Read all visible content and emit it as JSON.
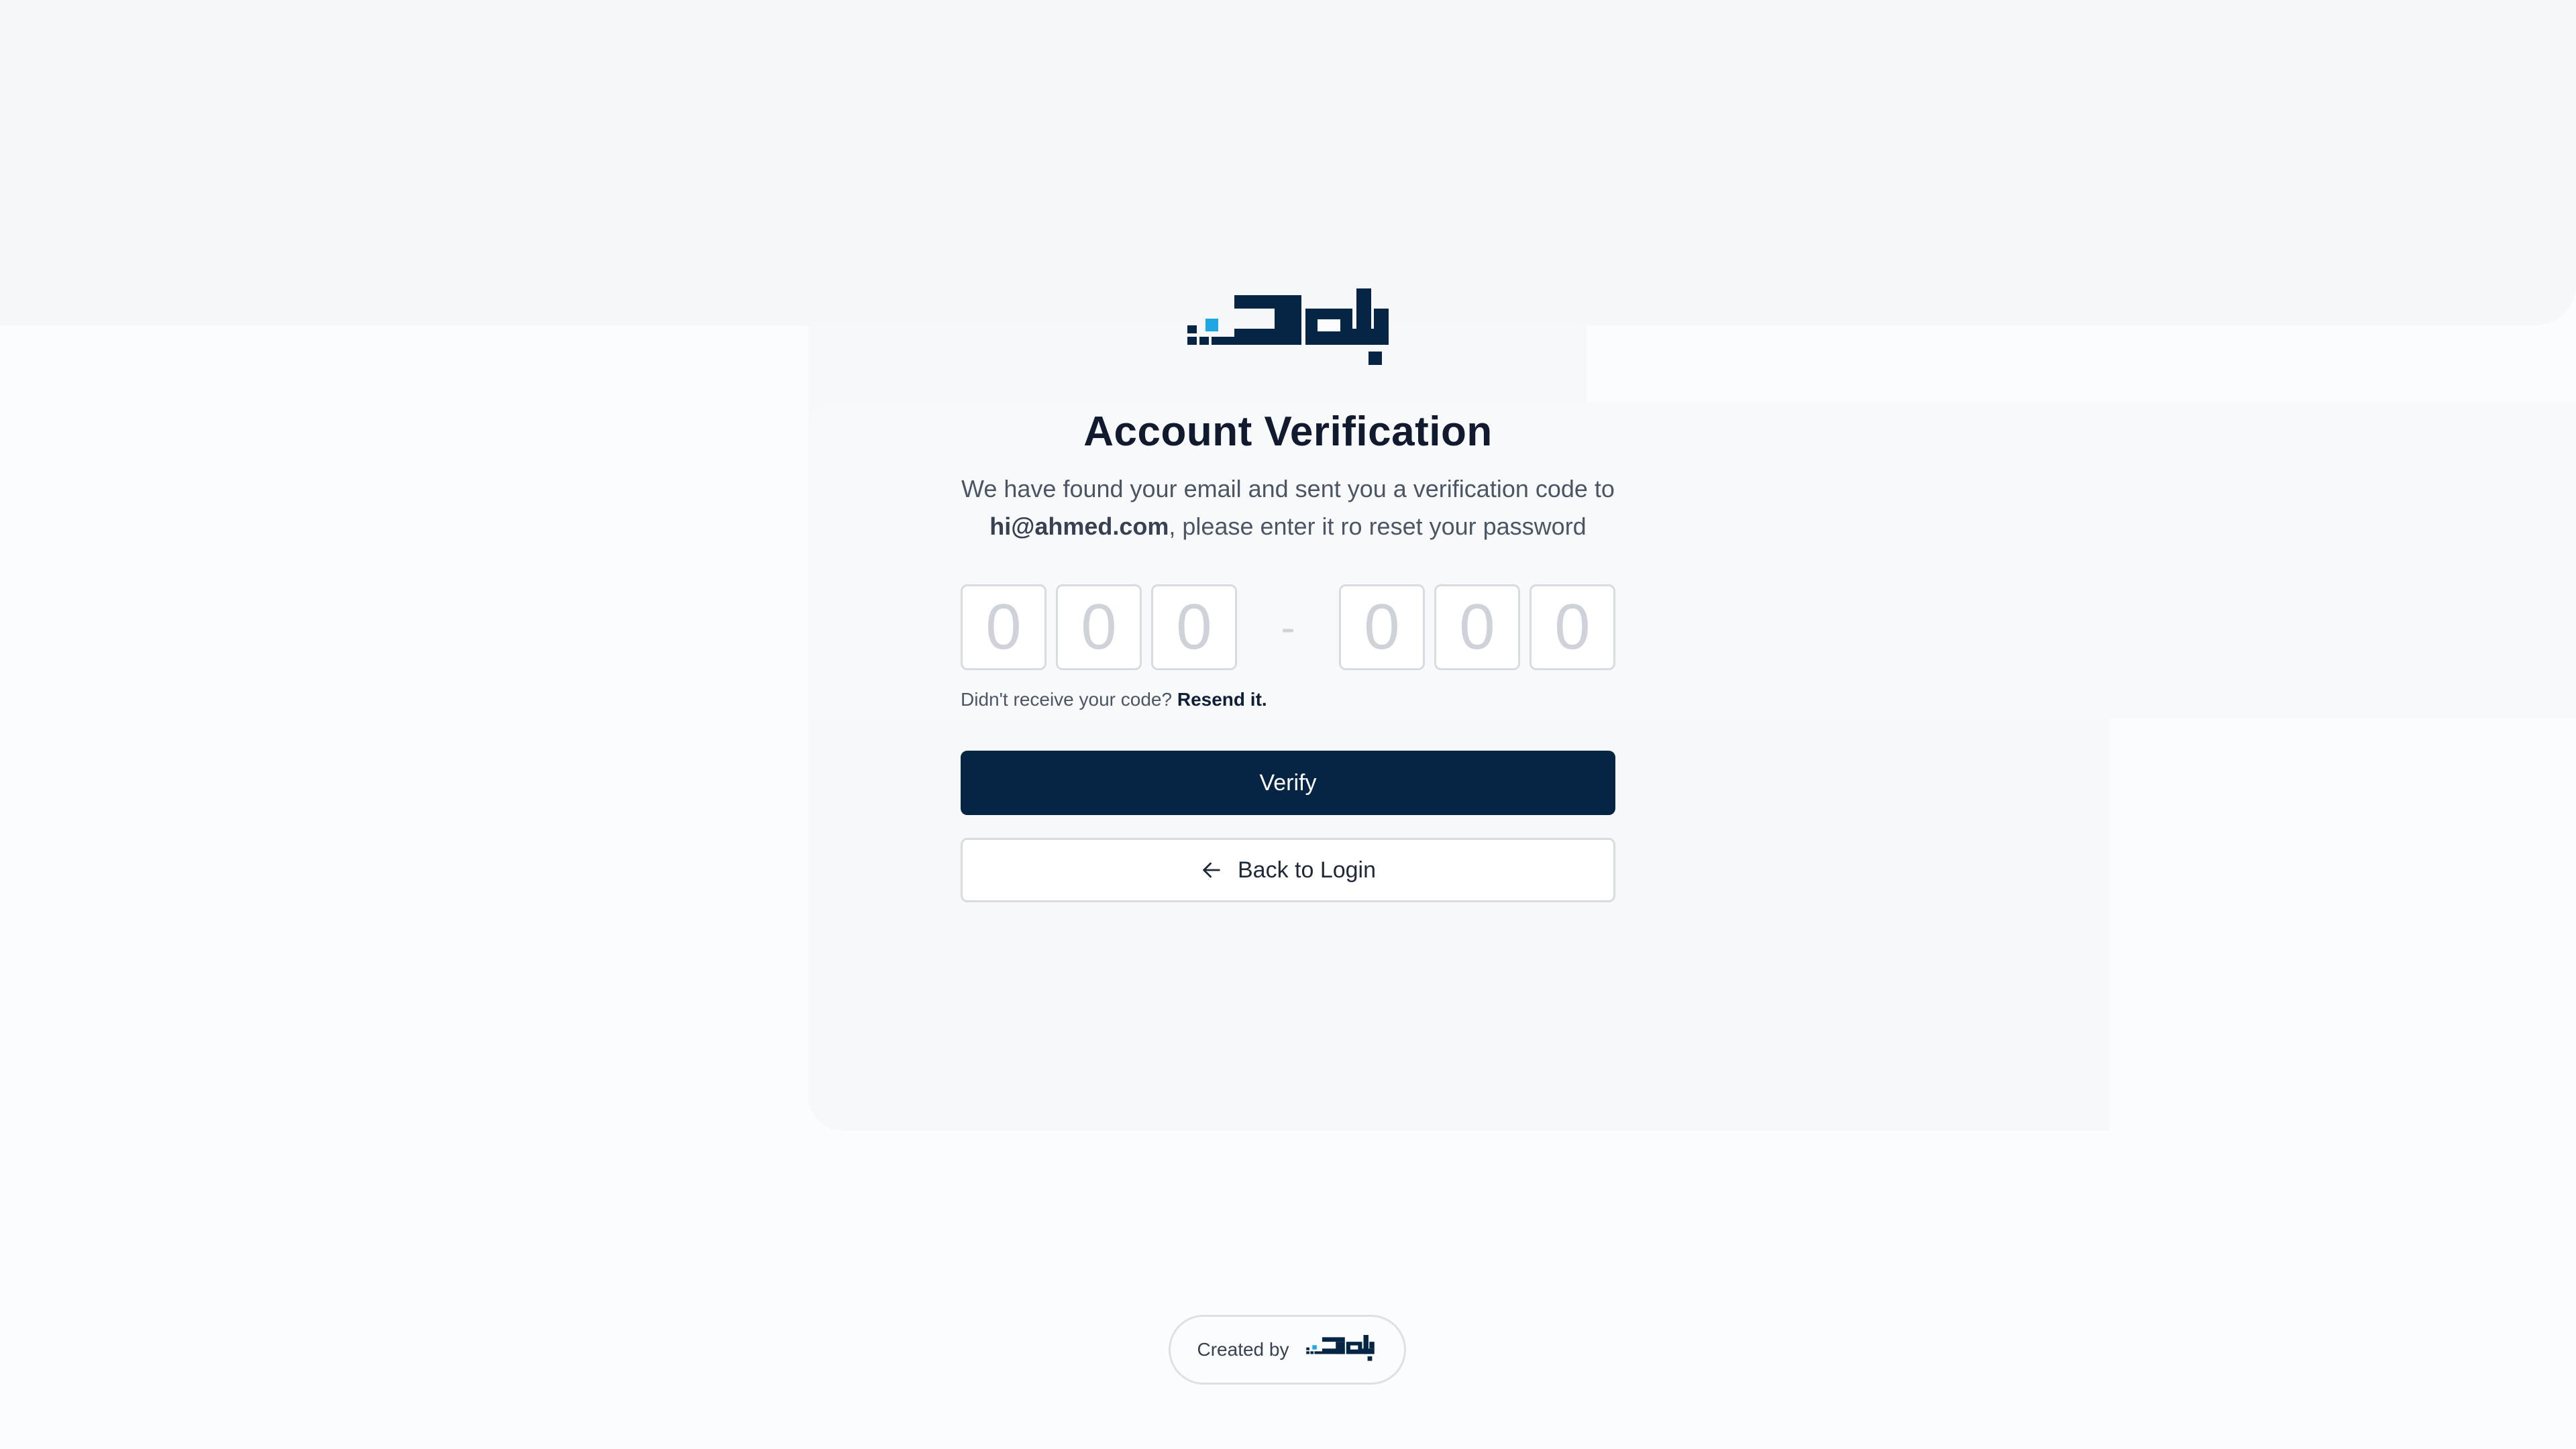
{
  "brand": {
    "logo_icon": "blok-arabic-logo",
    "primary_color": "#062544",
    "accent_color": "#1ea7e4"
  },
  "page": {
    "title": "Account Verification",
    "subtitle_line1": "We have found your email and sent you a verification code to",
    "email": "hi@ahmed.com",
    "subtitle_line2_rest": ", please enter it ro reset your password"
  },
  "otp": {
    "digits": [
      "0",
      "0",
      "0",
      "0",
      "0",
      "0"
    ],
    "separator": "-"
  },
  "resend": {
    "prompt": "Didn't receive your code?",
    "link": "Resend it."
  },
  "buttons": {
    "verify": "Verify",
    "back": "Back to Login",
    "back_icon": "arrow-left-icon"
  },
  "footer": {
    "created_by": "Created by",
    "logo_icon": "blok-arabic-logo"
  }
}
